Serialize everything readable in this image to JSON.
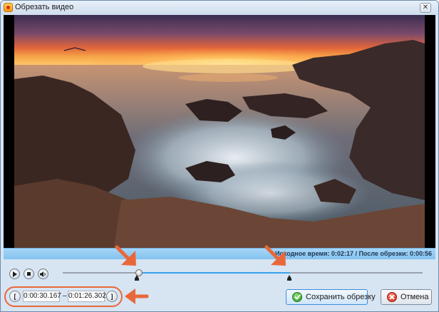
{
  "window": {
    "title": "Обрезать видео",
    "close_glyph": "✕"
  },
  "info": {
    "text": "Исходное время:  0:02:17 / После обрезки: 0:00:56"
  },
  "playback": {
    "play_icon": "play-icon",
    "stop_icon": "stop-icon",
    "volume_icon": "volume-icon"
  },
  "timeline": {
    "selection_start_fraction": 0.22,
    "selection_end_fraction": 0.64
  },
  "trim": {
    "start_bracket": "[",
    "start_time": "0:00:30.167",
    "separator": "–",
    "end_time": "0:01:26.302",
    "end_bracket": "]"
  },
  "buttons": {
    "save_label": "Сохранить обрезку",
    "cancel_label": "Отмена"
  },
  "colors": {
    "accent": "#36a3f0",
    "annotation": "#e9683a"
  }
}
